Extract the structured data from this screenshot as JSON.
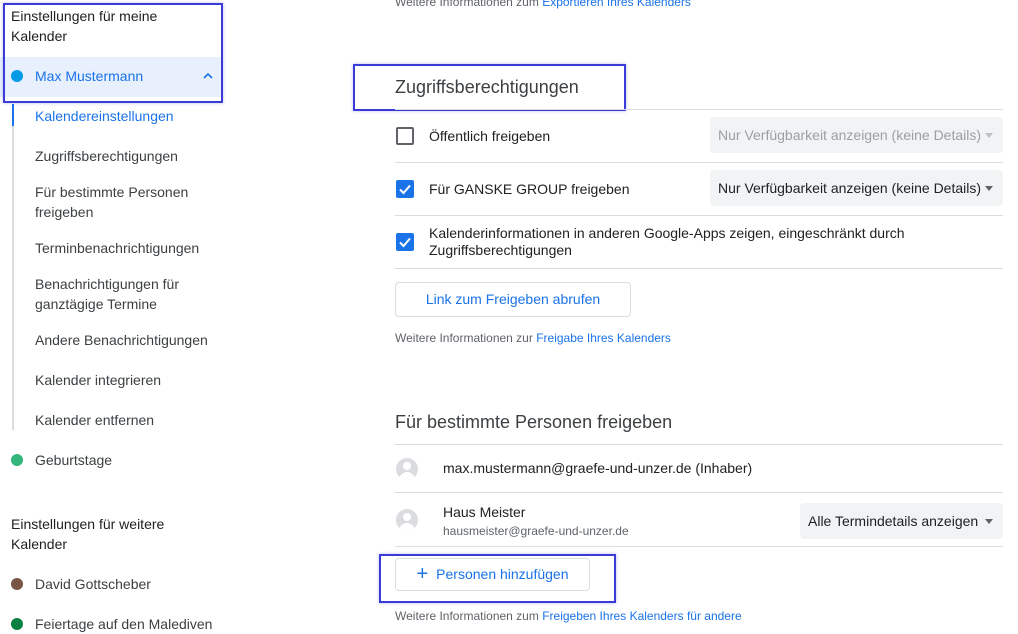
{
  "sidebar": {
    "section1_heading_line1": "Einstellungen für meine",
    "section1_heading_line2": "Kalender",
    "active_calendar": {
      "label": "Max Mustermann",
      "color": "#039be5"
    },
    "sub_items": {
      "kalendereinstellungen": "Kalendereinstellungen",
      "zugriffsberechtigungen": "Zugriffsberechtigungen",
      "bestimmte_personen_line1": "Für bestimmte Personen",
      "bestimmte_personen_line2": "freigeben",
      "terminbenachrichtigungen": "Terminbenachrichtigungen",
      "ganztaegig_line1": "Benachrichtigungen für",
      "ganztaegig_line2": "ganztägige Termine",
      "andere_benachrichtigungen": "Andere Benachrichtigungen",
      "kalender_integrieren": "Kalender integrieren",
      "kalender_entfernen": "Kalender entfernen"
    },
    "geburtstage": {
      "label": "Geburtstage",
      "color": "#33b679"
    },
    "section2_heading_line1": "Einstellungen für weitere",
    "section2_heading_line2": "Kalender",
    "other_calendars": [
      {
        "label": "David Gottscheber",
        "color": "#795548"
      },
      {
        "label": "Feiertage auf den Malediven",
        "color": "#0b8043"
      }
    ]
  },
  "main": {
    "top_info": {
      "prefix": "Weitere Informationen zum ",
      "link": "Exportieren Ihres Kalenders"
    },
    "access": {
      "title": "Zugriffsberechtigungen",
      "public_label": "Öffentlich freigeben",
      "public_checked": false,
      "public_select": "Nur Verfügbarkeit anzeigen (keine Details)",
      "org_label": "Für GANSKE GROUP freigeben",
      "org_checked": true,
      "org_select": "Nur Verfügbarkeit anzeigen (keine Details)",
      "apps_label_line1": "Kalenderinformationen in anderen Google-Apps zeigen, eingeschränkt durch",
      "apps_label_line2": "Zugriffsberechtigungen",
      "apps_checked": true,
      "link_button": "Link zum Freigeben abrufen",
      "info_prefix": "Weitere Informationen zur ",
      "info_link": "Freigabe Ihres Kalenders"
    },
    "share": {
      "title": "Für bestimmte Personen freigeben",
      "owner": "max.mustermann@graefe-und-unzer.de (Inhaber)",
      "person_name": "Haus Meister",
      "person_email": "hausmeister@graefe-und-unzer.de",
      "person_permission": "Alle Termindetails anzeigen",
      "add_icon": "+",
      "add_button": "Personen hinzufügen",
      "info_prefix": "Weitere Informationen zum ",
      "info_link": "Freigeben Ihres Kalenders für andere"
    }
  },
  "colors": {
    "accent": "#1a73e8",
    "annotation": "#3b3bd6"
  }
}
